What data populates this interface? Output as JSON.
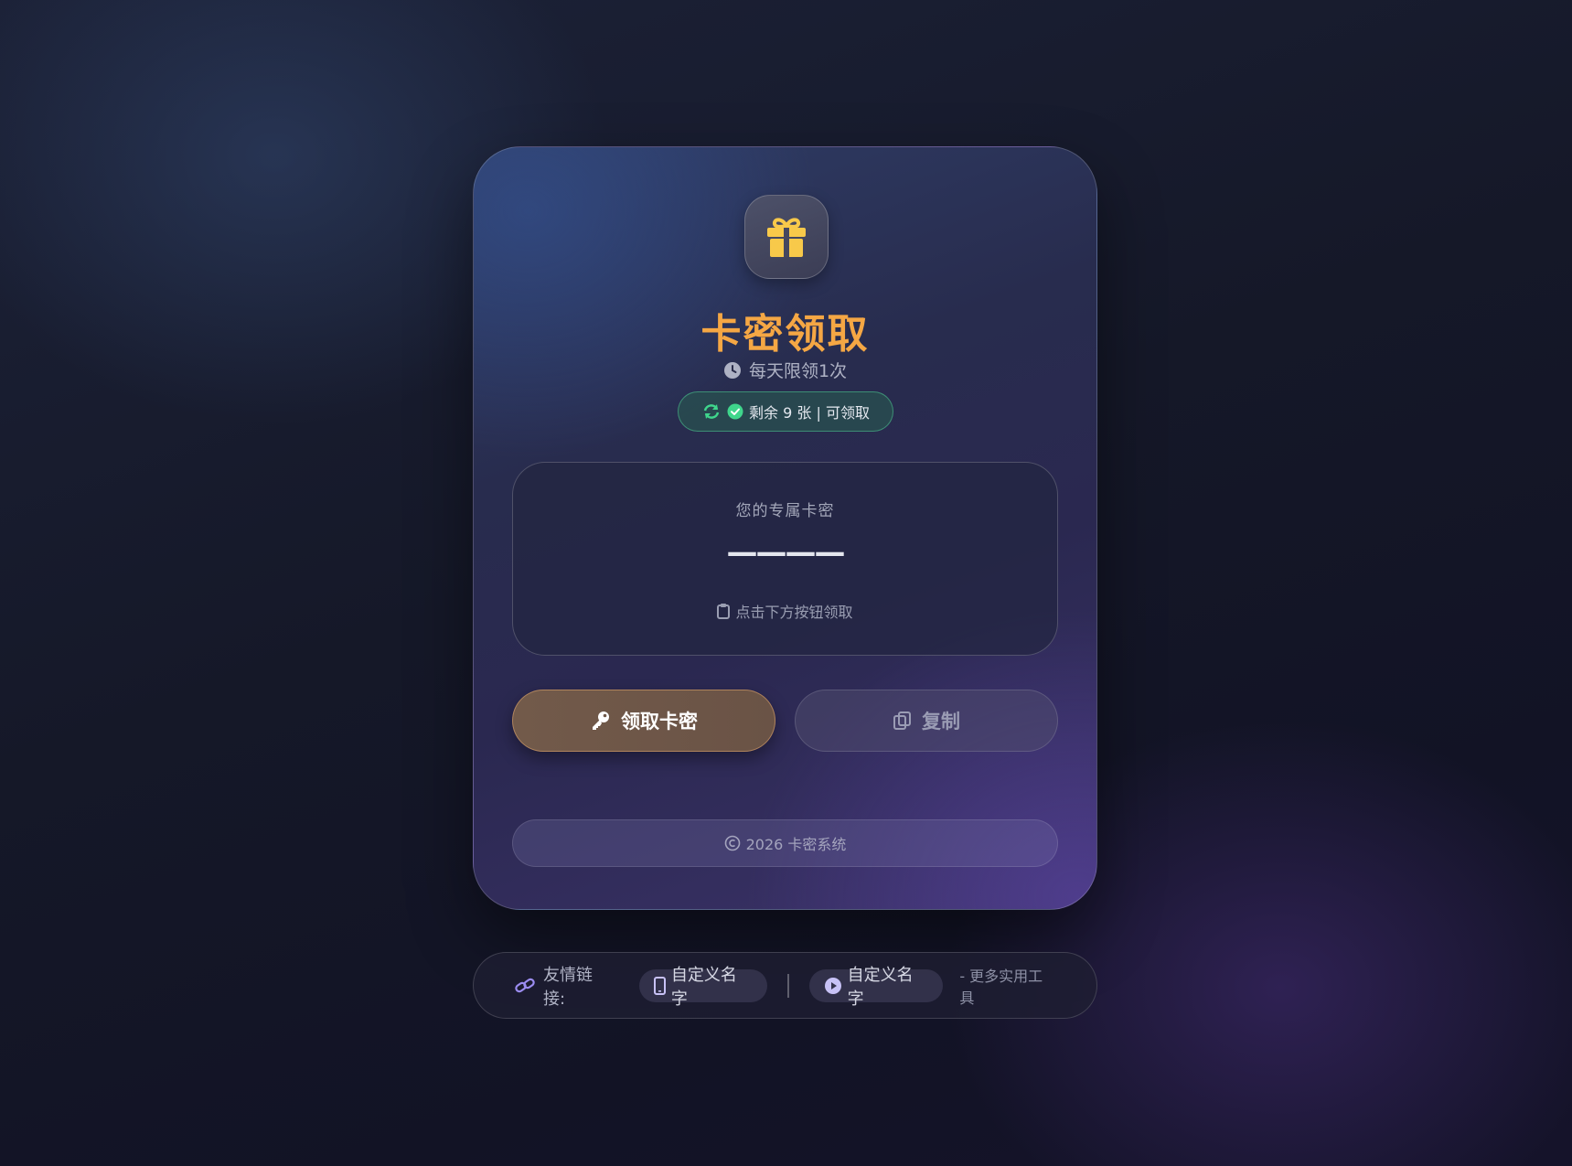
{
  "card": {
    "title": "卡密领取",
    "subtitle": "每天限领1次",
    "status": "剩余 9 张 | 可领取",
    "code_label": "您的专属卡密",
    "code_value": "————",
    "code_hint": "点击下方按钮领取",
    "claim_button": "领取卡密",
    "copy_button": "复制",
    "footer": "2026 卡密系统"
  },
  "links": {
    "label": "友情链接:",
    "items": [
      {
        "label": "自定义名字",
        "icon": "mobile-icon"
      },
      {
        "label": "自定义名字",
        "icon": "play-circle-icon"
      }
    ],
    "more": "- 更多实用工具"
  },
  "colors": {
    "title": "#f5a744",
    "gift": "#f8c94a",
    "status_green": "#3fd68c",
    "link_icon": "#9b8cf0"
  }
}
